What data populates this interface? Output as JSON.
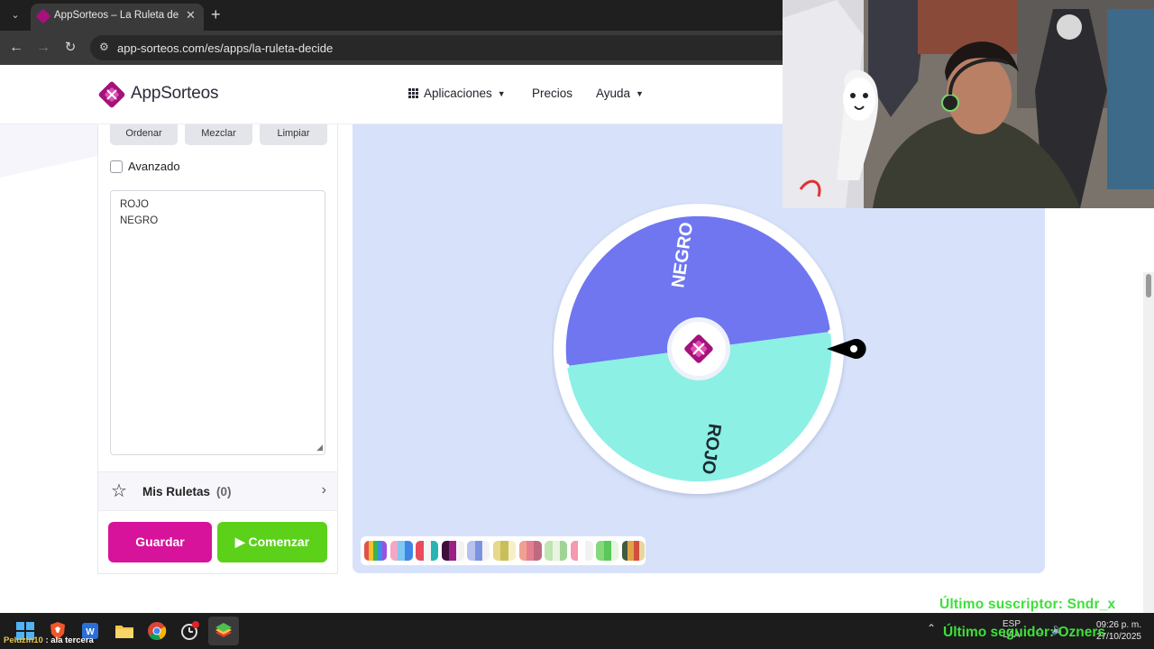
{
  "browser": {
    "tab_title": "AppSorteos – La Ruleta de la Suerte",
    "url": "app-sorteos.com/es/apps/la-ruleta-decide",
    "new_tab": "+",
    "close_tab": "✕"
  },
  "header": {
    "logo_text": "AppSorteos",
    "nav": {
      "apps": "Aplicaciones",
      "pricing": "Precios",
      "help": "Ayuda"
    }
  },
  "panel": {
    "tool_buttons": [
      "Ordenar",
      "Mezclar",
      "Limpiar"
    ],
    "advanced_label": "Avanzado",
    "advanced_checked": false,
    "names": [
      "ROJO",
      "NEGRO"
    ],
    "my_wheels_label": "Mis Ruletas",
    "my_wheels_count": "(0)",
    "save_label": "Guardar",
    "start_label": "Comenzar"
  },
  "wheel": {
    "segments": [
      {
        "label": "NEGRO",
        "color": "#6f76f0"
      },
      {
        "label": "ROJO",
        "color": "#8cf0e4"
      }
    ],
    "background": "#d7e2fa",
    "pointer_color": "#000000"
  },
  "palettes": [
    [
      "#e2524a",
      "#f0c230",
      "#3bb54a",
      "#3a8ee6",
      "#9b51e0"
    ],
    [
      "#f3a7c4",
      "#7ec8f2",
      "#3f86e8"
    ],
    [
      "#e84c5a",
      "#f5f5f5",
      "#26b5b0"
    ],
    [
      "#3d0f3a",
      "#9c1f86",
      "#f2f2f2"
    ],
    [
      "#b6c3ec",
      "#7c93e0",
      "#f2f2f2"
    ],
    [
      "#e6d98a",
      "#c9bf5a",
      "#f6f0c8"
    ],
    [
      "#f0a090",
      "#e57f8f",
      "#c06a80"
    ],
    [
      "#bfe5b1",
      "#e8f4e0",
      "#9fd495"
    ],
    [
      "#f59ab0",
      "#ffffff",
      "#f2f2f2"
    ],
    [
      "#86d97a",
      "#5bc85a",
      "#e6f6e0"
    ],
    [
      "#3e5b3f",
      "#e2a24a",
      "#d1503c",
      "#e8d6a0"
    ]
  ],
  "overlay": {
    "last_subscriber": "Último suscriptor: Sndr_x",
    "last_follower": "Último seguidor: Ozners"
  },
  "taskbar": {
    "chat_user": "Peluzin10",
    "chat_msg": " : ala tercera",
    "lang_line1": "ESP",
    "lang_line2": "LAA",
    "time": "09:26 p. m.",
    "date": "27/10/2025"
  }
}
